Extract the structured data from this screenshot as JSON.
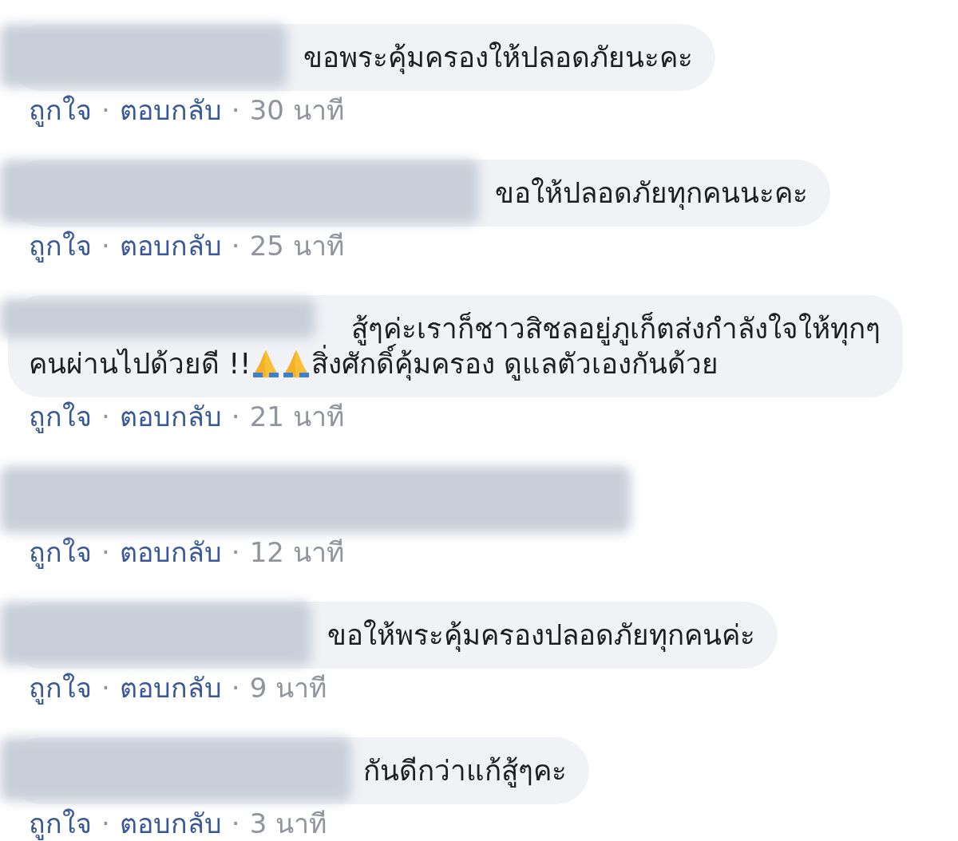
{
  "comments": [
    {
      "lines": [
        [
          {
            "kind": "text",
            "text": "ขอพระคุ้มครองให้ปลอดภัยนะคะ"
          }
        ]
      ],
      "like": "ถูกใจ",
      "reply": "ตอบกลับ",
      "time": "30 นาที",
      "separators": [
        "·",
        "·"
      ]
    },
    {
      "lines": [
        [
          {
            "kind": "text",
            "text": "ขอให้ปลอดภัยทุกคนนะคะ"
          }
        ]
      ],
      "like": "ถูกใจ",
      "reply": "ตอบกลับ",
      "time": "25 นาที",
      "separators": [
        "·",
        "·"
      ]
    },
    {
      "lines": [
        [
          {
            "kind": "text",
            "text": "สู้ๆค่ะเราก็ชาวสิชลอยู่ภูเก็ตส่งกำลังใจให้ทุกๆ"
          }
        ],
        [
          {
            "kind": "text",
            "text": "คนผ่านไปด้วยดี !!"
          },
          {
            "kind": "emoji"
          },
          {
            "kind": "emoji"
          },
          {
            "kind": "text",
            "text": "สิ่งศักดิ์คุ้มครอง ดูแลตัวเองกันด้วย"
          }
        ]
      ],
      "like": "ถูกใจ",
      "reply": "ตอบกลับ",
      "time": "21 นาที",
      "separators": [
        "·",
        "·"
      ]
    },
    {
      "like": "ถูกใจ",
      "reply": "ตอบกลับ",
      "time": "12 นาที",
      "separators": [
        "·",
        "·"
      ]
    },
    {
      "lines": [
        [
          {
            "kind": "text",
            "text": "ขอให้พระคุ้มครองปลอดภัยทุกคนค่ะ"
          }
        ]
      ],
      "like": "ถูกใจ",
      "reply": "ตอบกลับ",
      "time": "9 นาที",
      "separators": [
        "·",
        "·"
      ]
    },
    {
      "lines": [
        [
          {
            "kind": "text",
            "text": "กันดีกว่าแก้สู้ๆคะ"
          }
        ]
      ],
      "like": "ถูกใจ",
      "reply": "ตอบกลับ",
      "time": "3 นาที",
      "separators": [
        "·",
        "·"
      ]
    }
  ]
}
